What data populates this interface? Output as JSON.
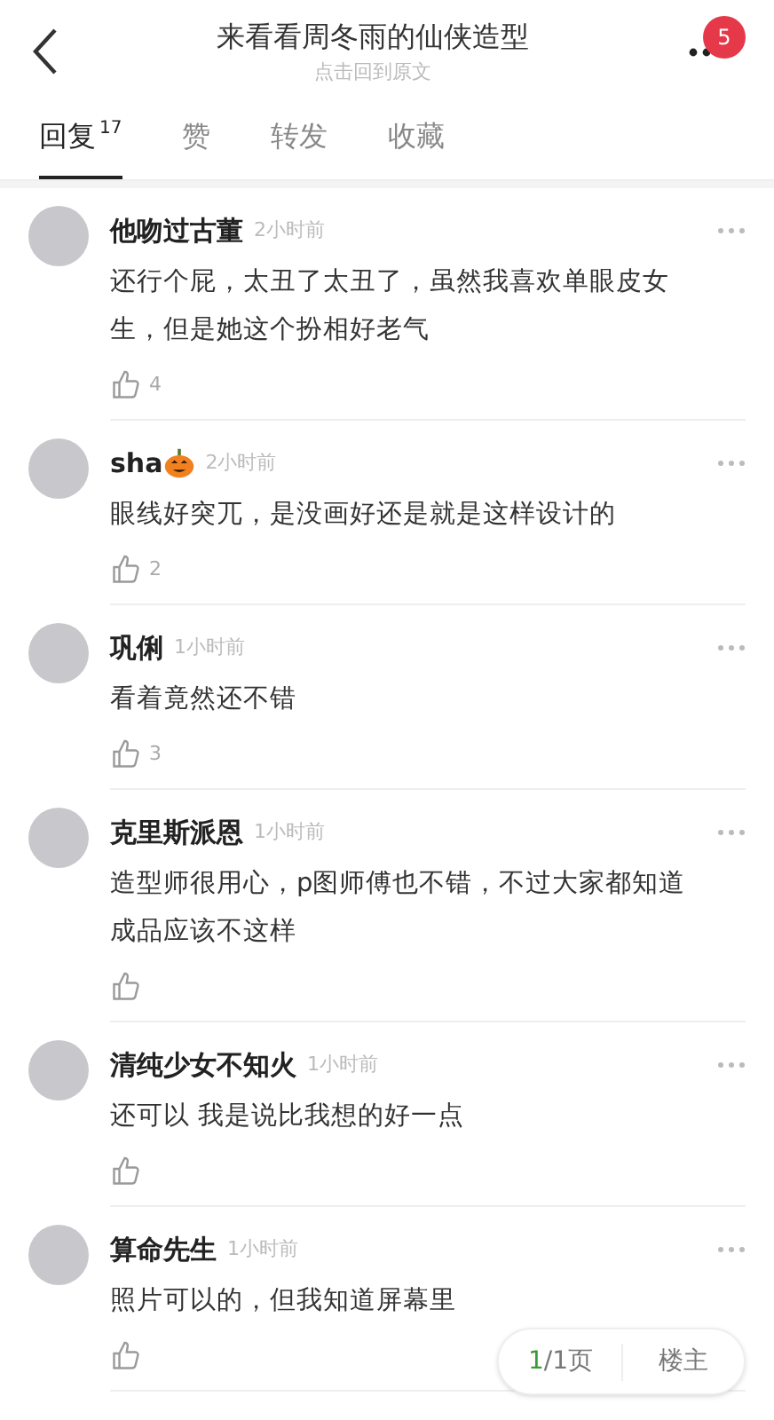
{
  "header": {
    "title": "来看看周冬雨的仙侠造型",
    "subtitle": "点击回到原文",
    "badge": "5"
  },
  "tabs": [
    {
      "label": "回复",
      "count": "17",
      "selected": true
    },
    {
      "label": "赞",
      "selected": false
    },
    {
      "label": "转发",
      "selected": false
    },
    {
      "label": "收藏",
      "selected": false
    }
  ],
  "comments": [
    {
      "user": "他吻过古董",
      "time": "2小时前",
      "text": "还行个屁，太丑了太丑了，虽然我喜欢单眼皮女生，但是她这个扮相好老气",
      "likes": "4",
      "user_badge": false
    },
    {
      "user": "sha",
      "time": "2小时前",
      "text": "眼线好突兀，是没画好还是就是这样设计的",
      "likes": "2",
      "user_badge": true
    },
    {
      "user": "巩俐",
      "time": "1小时前",
      "text": "看着竟然还不错",
      "likes": "3",
      "user_badge": false
    },
    {
      "user": "克里斯派恩",
      "time": "1小时前",
      "text": "造型师很用心，p图师傅也不错，不过大家都知道成品应该不这样",
      "user_badge": false
    },
    {
      "user": "清纯少女不知火",
      "time": "1小时前",
      "text": "还可以 我是说比我想的好一点",
      "user_badge": false
    },
    {
      "user": "算命先生",
      "time": "1小时前",
      "text": "照片可以的，但我知道屏幕里",
      "user_badge": false
    }
  ],
  "pager": {
    "current": "1",
    "total": "/1页",
    "owner_button": "楼主"
  }
}
